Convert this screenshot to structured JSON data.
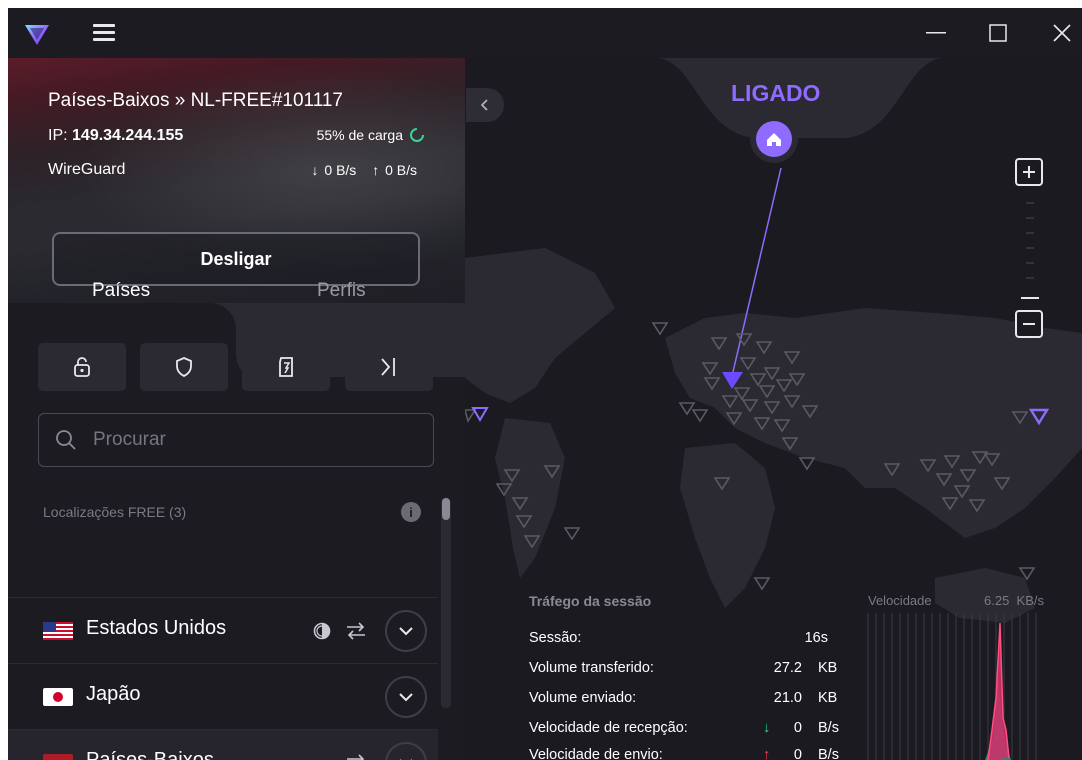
{
  "window": {
    "controls": {
      "minimize": "—",
      "maximize": "☐",
      "close": "✕"
    }
  },
  "connection": {
    "server": "Países-Baixos » NL-FREE#101117",
    "ip_label": "IP:",
    "ip": "149.34.244.155",
    "load": "55% de carga",
    "protocol": "WireGuard",
    "download": "0 B/s",
    "upload": "0 B/s",
    "disconnect_label": "Desligar"
  },
  "tabs": [
    {
      "label": "Países",
      "active": true
    },
    {
      "label": "Perfis",
      "active": false
    }
  ],
  "filters": [
    "lock-icon",
    "shield-icon",
    "secure-core-icon",
    "skip-icon"
  ],
  "search": {
    "placeholder": "Procurar"
  },
  "section": {
    "title": "Localizações FREE (3)",
    "info": "i"
  },
  "countries": [
    {
      "name": "Estados Unidos",
      "flag": "us"
    },
    {
      "name": "Japão",
      "flag": "jp"
    },
    {
      "name": "Países-Baixos",
      "flag": "nl"
    }
  ],
  "map": {
    "status": "LIGADO",
    "colors": {
      "accent": "#8f6bff",
      "marker": "#6d4aff"
    }
  },
  "session": {
    "title": "Tráfego da sessão",
    "rows": [
      {
        "label": "Sessão:",
        "value": "16s",
        "unit": ""
      },
      {
        "label": "Volume transferido:",
        "value": "27.2",
        "unit": "KB"
      },
      {
        "label": "Volume enviado:",
        "value": "21.0",
        "unit": "KB"
      },
      {
        "label": "Velocidade de recepção:",
        "value": "0",
        "unit": "B/s",
        "arrow": "↓"
      },
      {
        "label": "Velocidade de envio:",
        "value": "0",
        "unit": "B/s",
        "arrow": "↑"
      }
    ]
  },
  "speed_graph": {
    "label": "Velocidade",
    "max": "6.25",
    "max_unit": "KB/s"
  }
}
